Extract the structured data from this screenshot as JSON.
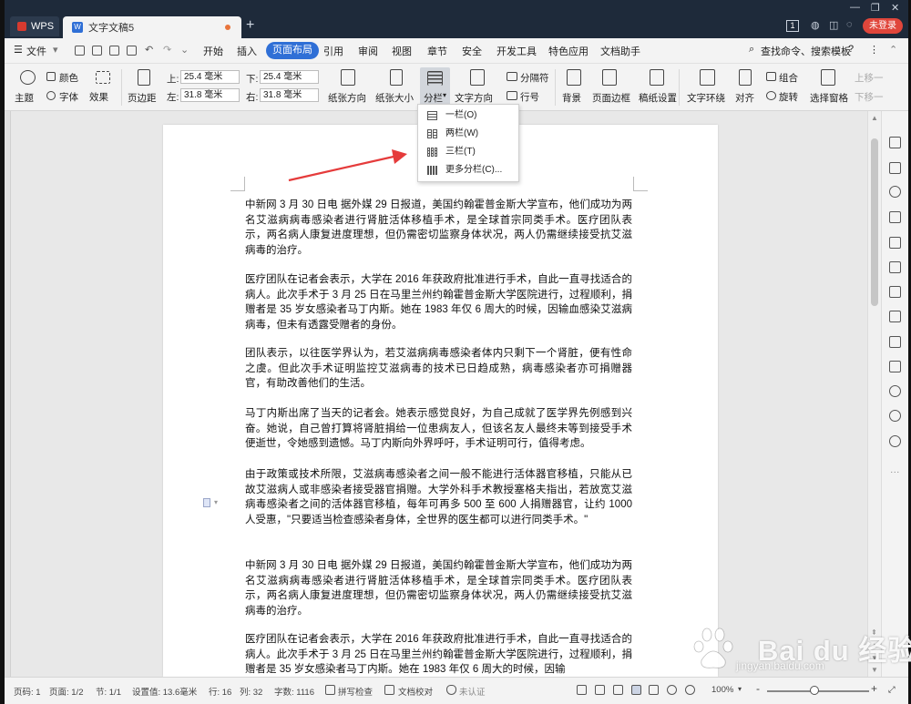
{
  "titlebar": {
    "wps_label": "WPS",
    "doc_tab_title": "文字文稿5",
    "new_tab": "+",
    "badge": "1",
    "login": "未登录"
  },
  "menu": {
    "file": "文件",
    "items": [
      "开始",
      "插入",
      "页面布局",
      "引用",
      "审阅",
      "视图",
      "章节",
      "安全",
      "开发工具",
      "特色应用",
      "文档助手"
    ],
    "active": "页面布局",
    "search": "查找命令、搜索模板",
    "help": "?",
    "more": "⋮"
  },
  "ribbon": {
    "theme": "主题",
    "color": "颜色",
    "font": "字体",
    "effect": "效果",
    "margins": "页边距",
    "top_label": "上:",
    "top_value": "25.4 毫米",
    "bottom_label": "下:",
    "bottom_value": "25.4 毫米",
    "left_label": "左:",
    "left_value": "31.8 毫米",
    "right_label": "右:",
    "right_value": "31.8 毫米",
    "orientation": "纸张方向",
    "size": "纸张大小",
    "columns": "分栏",
    "text_direction": "文字方向",
    "separator": "分隔符",
    "line_number": "行号",
    "background": "背景",
    "page_border": "页面边框",
    "paper_setting": "稿纸设置",
    "text_wrap": "文字环绕",
    "align": "对齐",
    "group": "组合",
    "rotate": "旋转",
    "selection_pane": "选择窗格",
    "bring_forward": "上移一",
    "send_backward": "下移一"
  },
  "columns_dropdown": {
    "items": [
      "一栏(O)",
      "两栏(W)",
      "三栏(T)",
      "更多分栏(C)..."
    ]
  },
  "document": {
    "paragraphs": [
      "中新网 3 月 30 日电  据外媒 29 日报道，美国约翰霍普金斯大学宣布，他们成功为两名艾滋病病毒感染者进行肾脏活体移植手术，是全球首宗同类手术。医疗团队表示，两名病人康复进度理想，但仍需密切监察身体状况，两人仍需继续接受抗艾滋病毒的治疗。",
      "医疗团队在记者会表示，大学在 2016 年获政府批准进行手术，自此一直寻找适合的病人。此次手术于 3 月 25 日在马里兰州约翰霍普金斯大学医院进行，过程顺利，捐赠者是 35 岁女感染者马丁内斯。她在 1983 年仅 6 周大的时候，因输血感染艾滋病病毒，但未有透露受赠者的身份。",
      "团队表示，以往医学界认为，若艾滋病病毒感染者体内只剩下一个肾脏，便有性命之虞。但此次手术证明监控艾滋病毒的技术已日趋成熟，病毒感染者亦可捐赠器官，有助改善他们的生活。",
      "马丁内斯出席了当天的记者会。她表示感觉良好，为自己成就了医学界先例感到兴奋。她说，自己曾打算将肾脏捐给一位患病友人，但该名友人最终未等到接受手术便逝世，令她感到遗憾。马丁内斯向外界呼吁，手术证明可行，值得考虑。",
      "由于政策或技术所限，艾滋病毒感染者之间一般不能进行活体器官移植，只能从已故艾滋病人或非感染者接受器官捐赠。大学外科手术教授塞格夫指出，若放宽艾滋病毒感染者之间的活体器官移植，每年可再多 500 至 600 人捐赠器官，让约 1000 人受惠，\"只要适当检查感染者身体，全世界的医生都可以进行同类手术。\"",
      "中新网 3 月 30 日电  据外媒 29 日报道，美国约翰霍普金斯大学宣布，他们成功为两名艾滋病病毒感染者进行肾脏活体移植手术，是全球首宗同类手术。医疗团队表示，两名病人康复进度理想，但仍需密切监察身体状况，两人仍需继续接受抗艾滋病毒的治疗。",
      "医疗团队在记者会表示，大学在 2016 年获政府批准进行手术，自此一直寻找适合的病人。此次手术于 3 月 25 日在马里兰州约翰霍普金斯大学医院进行，过程顺利，捐赠者是 35 岁女感染者马丁内斯。她在 1983 年仅 6 周大的时候，因输"
    ]
  },
  "statusbar": {
    "page_code": "页码: 1",
    "page": "页面: 1/2",
    "section": "节: 1/1",
    "set_value": "设置值: 13.6毫米",
    "row": "行: 16",
    "col": "列: 32",
    "word_count": "字数: 1116",
    "spell_check": "拼写检查",
    "doc_check": "文档校对",
    "uncertified": "未认证",
    "zoom": "100%",
    "zoom_minus": "-",
    "zoom_plus": "+"
  },
  "watermark": {
    "text": "Bai du 经验",
    "url": "jingyan.baidu.com"
  },
  "colors": {
    "accent": "#2f6fd6",
    "titlebar": "#1e2a3a",
    "login": "#e0463b",
    "arrow": "#e53b3b"
  }
}
